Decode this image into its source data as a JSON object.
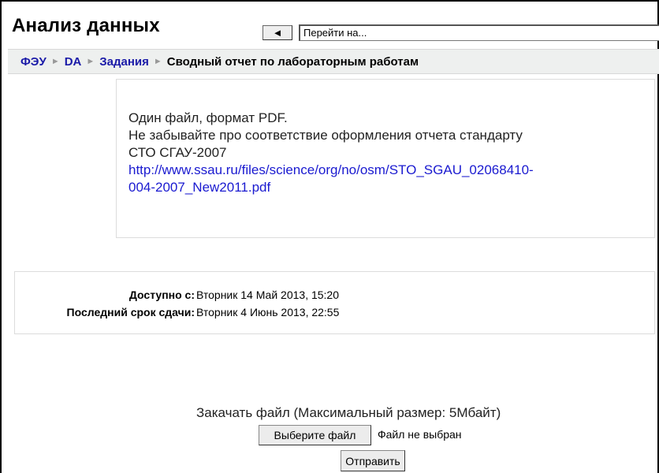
{
  "header": {
    "title": "Анализ данных",
    "back_glyph": "◄",
    "jump_label": "Перейти на..."
  },
  "breadcrumb": {
    "items": [
      "ФЭУ",
      "DA",
      "Задания",
      "Сводный отчет по лабораторным работам"
    ],
    "separator": "►"
  },
  "description": {
    "line1": "Один файл, формат PDF.",
    "line2": "Не забывайте про соответствие оформления отчета стандарту",
    "line3": "СТО СГАУ-2007",
    "link_line1": "http://www.ssau.ru/files/science/org/no/osm/STO_SGAU_02068410-",
    "link_line2": "004-2007_New2011.pdf"
  },
  "dates": {
    "available_label": "Доступно с:",
    "available_value": "Вторник 14 Май 2013, 15:20",
    "deadline_label": "Последний срок сдачи:",
    "deadline_value": "Вторник 4 Июнь 2013, 22:55"
  },
  "upload": {
    "title": "Закачать файл (Максимальный размер: 5Мбайт)",
    "choose_label": "Выберите файл",
    "no_file": "Файл не выбран",
    "submit_label": "Отправить"
  }
}
